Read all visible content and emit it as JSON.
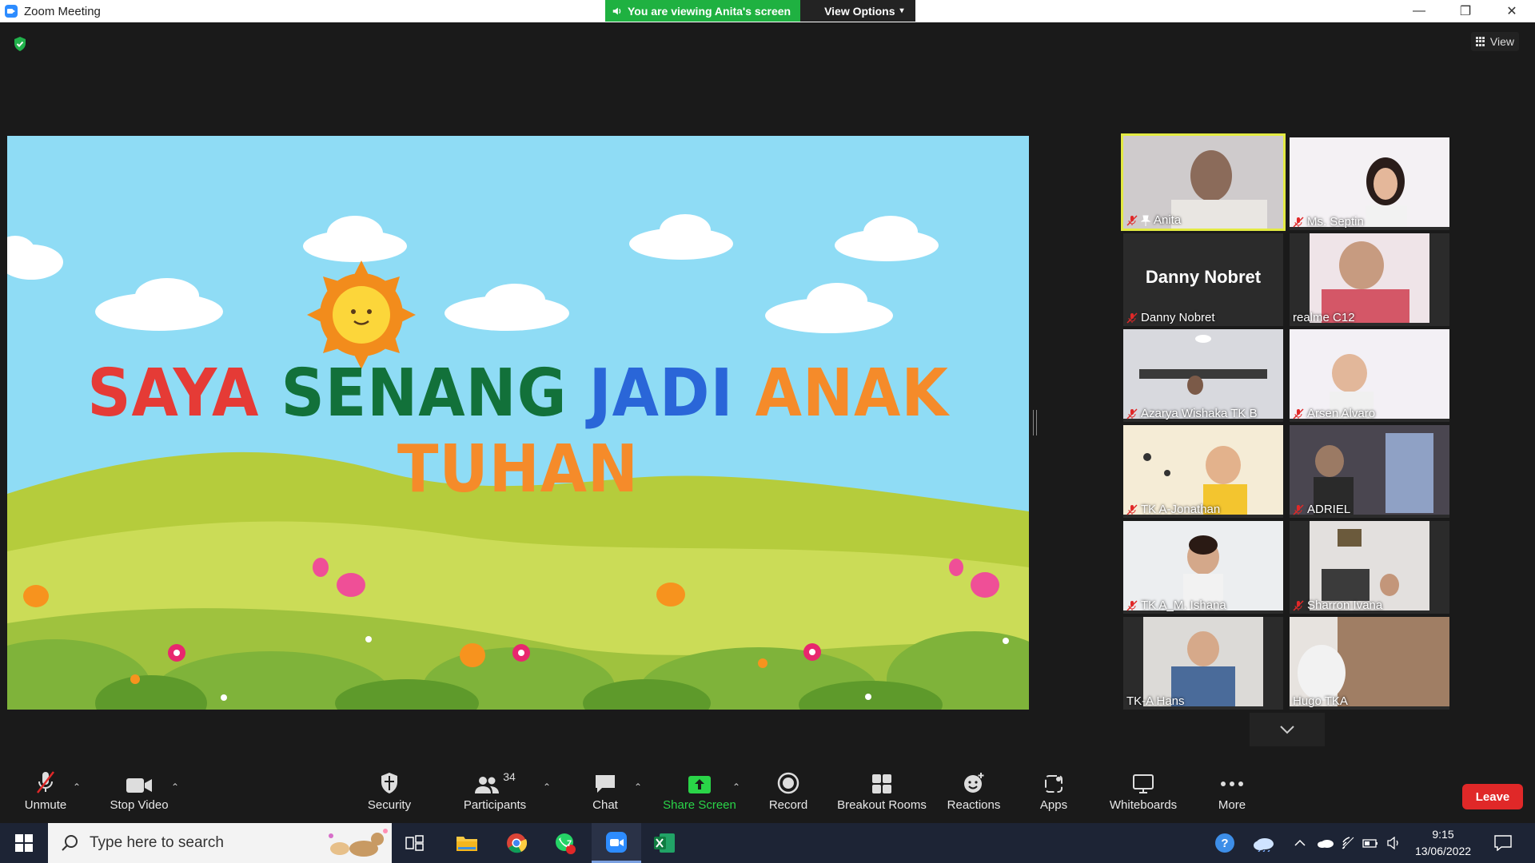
{
  "window": {
    "title": "Zoom Meeting",
    "share_status": "You are viewing Anita's screen",
    "view_options": "View Options",
    "view_label": "View"
  },
  "slide": {
    "word1": "SAYA",
    "word2": "SENANG",
    "word3": "JADI",
    "word4": "ANAK TUHAN"
  },
  "participants_tiles": [
    {
      "name": "Anita",
      "muted": true,
      "pinned": true,
      "active": true
    },
    {
      "name": "Ms. Septin",
      "muted": true
    },
    {
      "name": "Danny Nobret",
      "muted": true,
      "video_off": true,
      "display_name": "Danny Nobret"
    },
    {
      "name": "realme C12",
      "muted": false
    },
    {
      "name": "Azarya Wishaka  TK B",
      "muted": true
    },
    {
      "name": "Arsen Alvaro",
      "muted": true
    },
    {
      "name": "TK A-Jonathan",
      "muted": true
    },
    {
      "name": "ADRIEL",
      "muted": true
    },
    {
      "name": "TK A_M. Ishana",
      "muted": true
    },
    {
      "name": "Sharron Ivana",
      "muted": true
    },
    {
      "name": "TK-A Hans",
      "muted": false
    },
    {
      "name": "Hugo TKA",
      "muted": false
    }
  ],
  "toolbar": {
    "unmute": "Unmute",
    "stop_video": "Stop Video",
    "security": "Security",
    "participants": "Participants",
    "participants_count": "34",
    "chat": "Chat",
    "share_screen": "Share Screen",
    "record": "Record",
    "breakout_rooms": "Breakout Rooms",
    "reactions": "Reactions",
    "apps": "Apps",
    "whiteboards": "Whiteboards",
    "more": "More",
    "leave": "Leave"
  },
  "taskbar": {
    "search_placeholder": "Type here to search",
    "whatsapp_badge": "7",
    "time": "9:15",
    "date": "13/06/2022"
  },
  "colors": {
    "accent_green": "#1fb141",
    "leave_red": "#e02828",
    "active_speaker": "#e3ea42"
  }
}
